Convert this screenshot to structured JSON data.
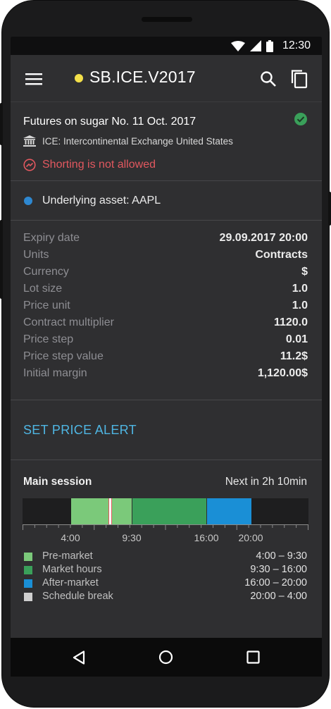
{
  "status_bar": {
    "time": "12:30"
  },
  "toolbar": {
    "title": "SB.ICE.V2017",
    "dot_color": "#f3e04a"
  },
  "instrument": {
    "name": "Futures on sugar No. 11 Oct. 2017",
    "exchange": "ICE: Intercontinental Exchange United States",
    "shorting": "Shorting is not allowed",
    "verified_icon": "check-circle-icon"
  },
  "underlying": {
    "label": "Underlying asset: AAPL",
    "dot_color": "#2e88d1"
  },
  "properties": [
    {
      "key": "Expiry date",
      "value": "29.09.2017 20:00"
    },
    {
      "key": "Units",
      "value": "Contracts"
    },
    {
      "key": "Currency",
      "value": "$"
    },
    {
      "key": "Lot size",
      "value": "1.0"
    },
    {
      "key": "Price unit",
      "value": "1.0"
    },
    {
      "key": "Contract multiplier",
      "value": "1120.0"
    },
    {
      "key": "Price step",
      "value": "0.01"
    },
    {
      "key": "Price step value",
      "value": "11.2$"
    },
    {
      "key": "Initial margin",
      "value": "1,120.00$"
    }
  ],
  "alert": {
    "label": "SET PRICE ALERT"
  },
  "session": {
    "title": "Main session",
    "next": "Next in 2h 10min",
    "axis_labels": [
      "4:00",
      "9:30",
      "16:00",
      "20:00"
    ],
    "legend": [
      {
        "name": "Pre-market",
        "range": "4:00 – 9:30",
        "color": "#7bc97a"
      },
      {
        "name": "Market hours",
        "range": "9:30 – 16:00",
        "color": "#3aa05a"
      },
      {
        "name": "After-market",
        "range": "16:00 – 20:00",
        "color": "#1a8fd6"
      },
      {
        "name": "Schedule break",
        "range": "20:00 – 4:00",
        "color": "#cfcfcf"
      }
    ]
  }
}
